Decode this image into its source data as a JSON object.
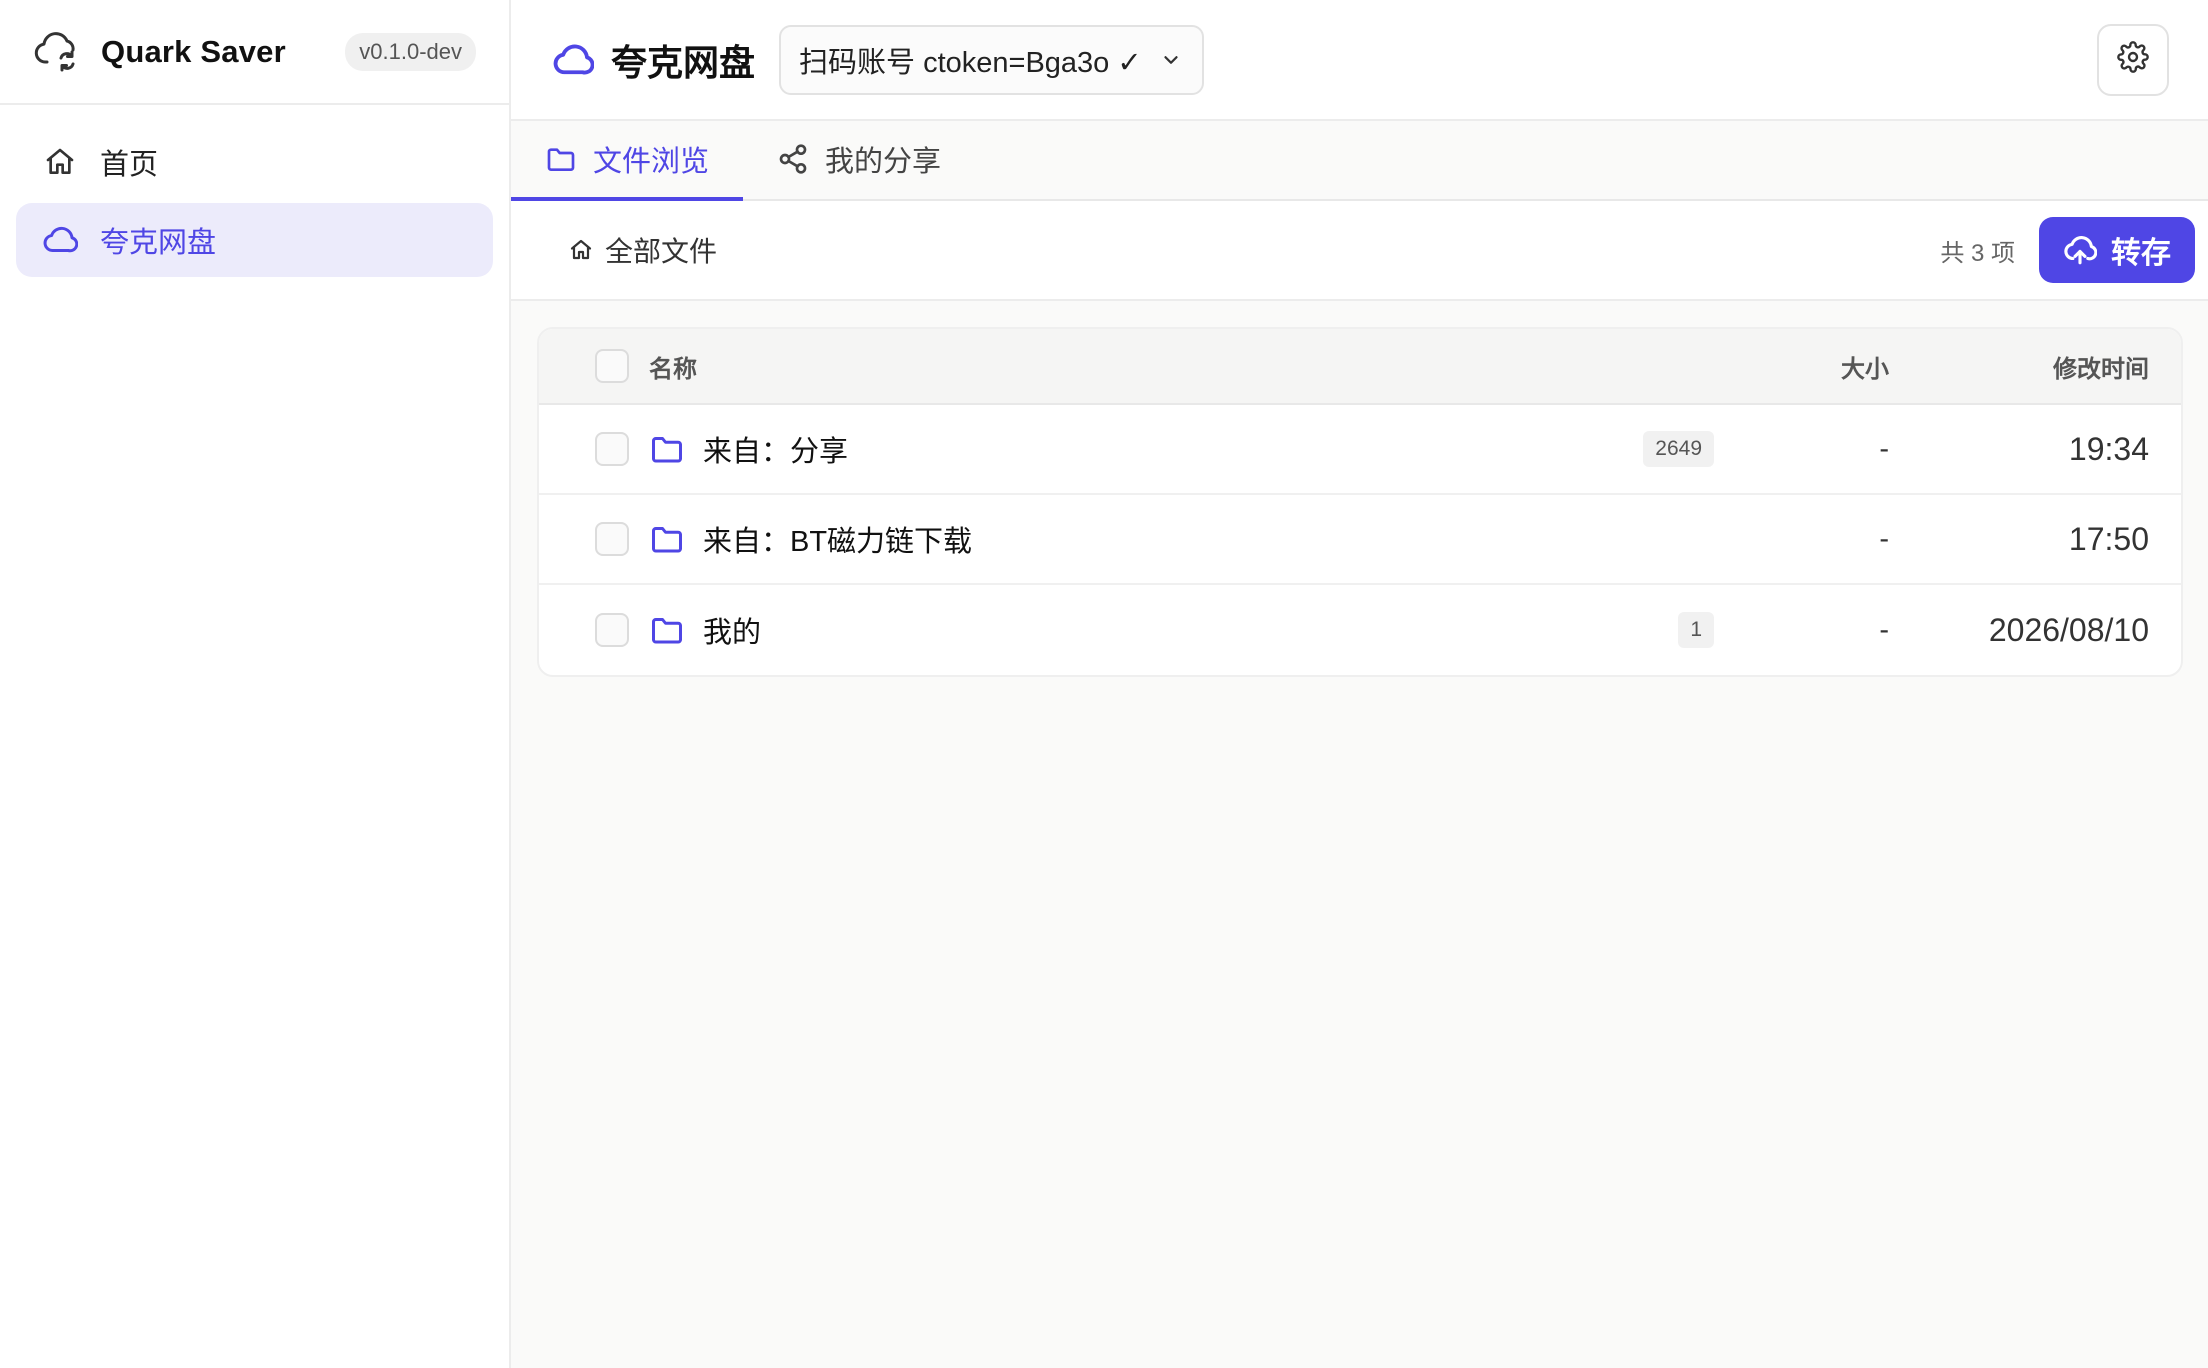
{
  "app": {
    "name": "Quark Saver",
    "version": "v0.1.0-dev"
  },
  "sidebar": {
    "items": [
      {
        "label": "首页",
        "icon": "home-icon",
        "active": false
      },
      {
        "label": "夸克网盘",
        "icon": "cloud-icon",
        "active": true
      }
    ]
  },
  "header": {
    "title": "夸克网盘",
    "account": "扫码账号 ctoken=Bga3o ✓"
  },
  "tabs": [
    {
      "label": "文件浏览",
      "icon": "folder-icon",
      "active": true
    },
    {
      "label": "我的分享",
      "icon": "share-icon",
      "active": false
    }
  ],
  "pathbar": {
    "crumb": "全部文件",
    "count": "共 3 项",
    "save_label": "转存"
  },
  "table": {
    "headers": {
      "name": "名称",
      "size": "大小",
      "time": "修改时间"
    },
    "rows": [
      {
        "name": "来自：分享",
        "badge": "2649",
        "size": "-",
        "time": "19:34"
      },
      {
        "name": "来自：BT磁力链下载",
        "badge": "",
        "size": "-",
        "time": "17:50"
      },
      {
        "name": "我的",
        "badge": "1",
        "size": "-",
        "time": "2026/08/10"
      }
    ]
  },
  "colors": {
    "accent": "#4f46e5",
    "active_bg": "#ecebfb"
  }
}
